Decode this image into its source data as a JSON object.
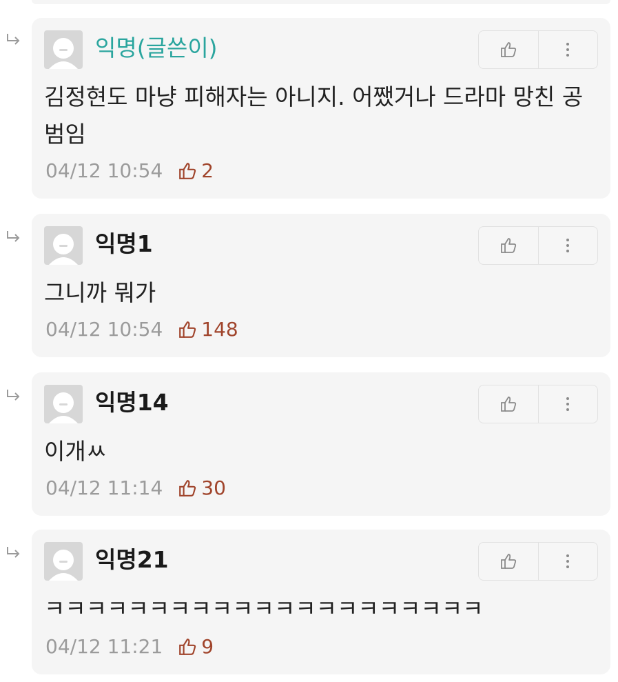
{
  "comments": [
    {
      "author": "익명(글쓴이)",
      "is_op": true,
      "text": "김정현도 마냥 피해자는 아니지. 어쨌거나 드라마 망친 공범임",
      "time": "04/12 10:54",
      "likes": "2"
    },
    {
      "author": "익명1",
      "is_op": false,
      "text": "그니까 뭐가",
      "time": "04/12 10:54",
      "likes": "148"
    },
    {
      "author": "익명14",
      "is_op": false,
      "text": "이개ㅆ",
      "time": "04/12 11:14",
      "likes": "30"
    },
    {
      "author": "익명21",
      "is_op": false,
      "text": "ㅋㅋㅋㅋㅋㅋㅋㅋㅋㅋㅋㅋㅋㅋㅋㅋㅋㅋㅋㅋㅋ",
      "time": "04/12 11:21",
      "likes": "9"
    }
  ],
  "icons": {
    "reply": "reply-arrow-icon",
    "avatar": "default-user-icon",
    "like": "thumbs-up-icon",
    "more": "more-vertical-icon"
  },
  "colors": {
    "op_name": "#2aa59e",
    "like_count": "#a0442b",
    "card_bg": "#f5f5f5",
    "meta_text": "#9b9b9b"
  }
}
